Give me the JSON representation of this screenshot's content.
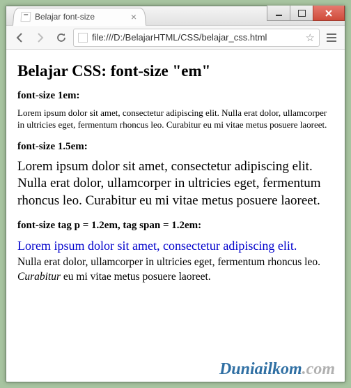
{
  "window": {
    "tab_title": "Belajar font-size"
  },
  "toolbar": {
    "url": "file:///D:/BelajarHTML/CSS/belajar_css.html"
  },
  "page": {
    "heading": "Belajar CSS: font-size \"em\"",
    "sections": {
      "s1": {
        "label": "font-size 1em:",
        "body": "Lorem ipsum dolor sit amet, consectetur adipiscing elit. Nulla erat dolor, ullamcorper in ultricies eget, fermentum rhoncus leo. Curabitur eu mi vitae metus posuere laoreet."
      },
      "s2": {
        "label": "font-size 1.5em:",
        "body": "Lorem ipsum dolor sit amet, consectetur adipiscing elit. Nulla erat dolor, ullamcorper in ultricies eget, fermentum rhoncus leo. Curabitur eu mi vitae metus posuere laoreet."
      },
      "s3": {
        "label": "font-size tag p = 1.2em, tag span = 1.2em:",
        "lead": "Lorem ipsum dolor sit amet, consectetur adipiscing elit.",
        "body_a": "Nulla erat dolor, ullamcorper in ultricies eget, fermentum rhoncus leo. ",
        "italic_word": "Curabitur",
        "body_b": " eu mi vitae metus posuere laoreet."
      }
    }
  },
  "watermark": {
    "brand_main": "Dunia",
    "brand_sub": "ilkom",
    "brand_tld": ".com"
  }
}
